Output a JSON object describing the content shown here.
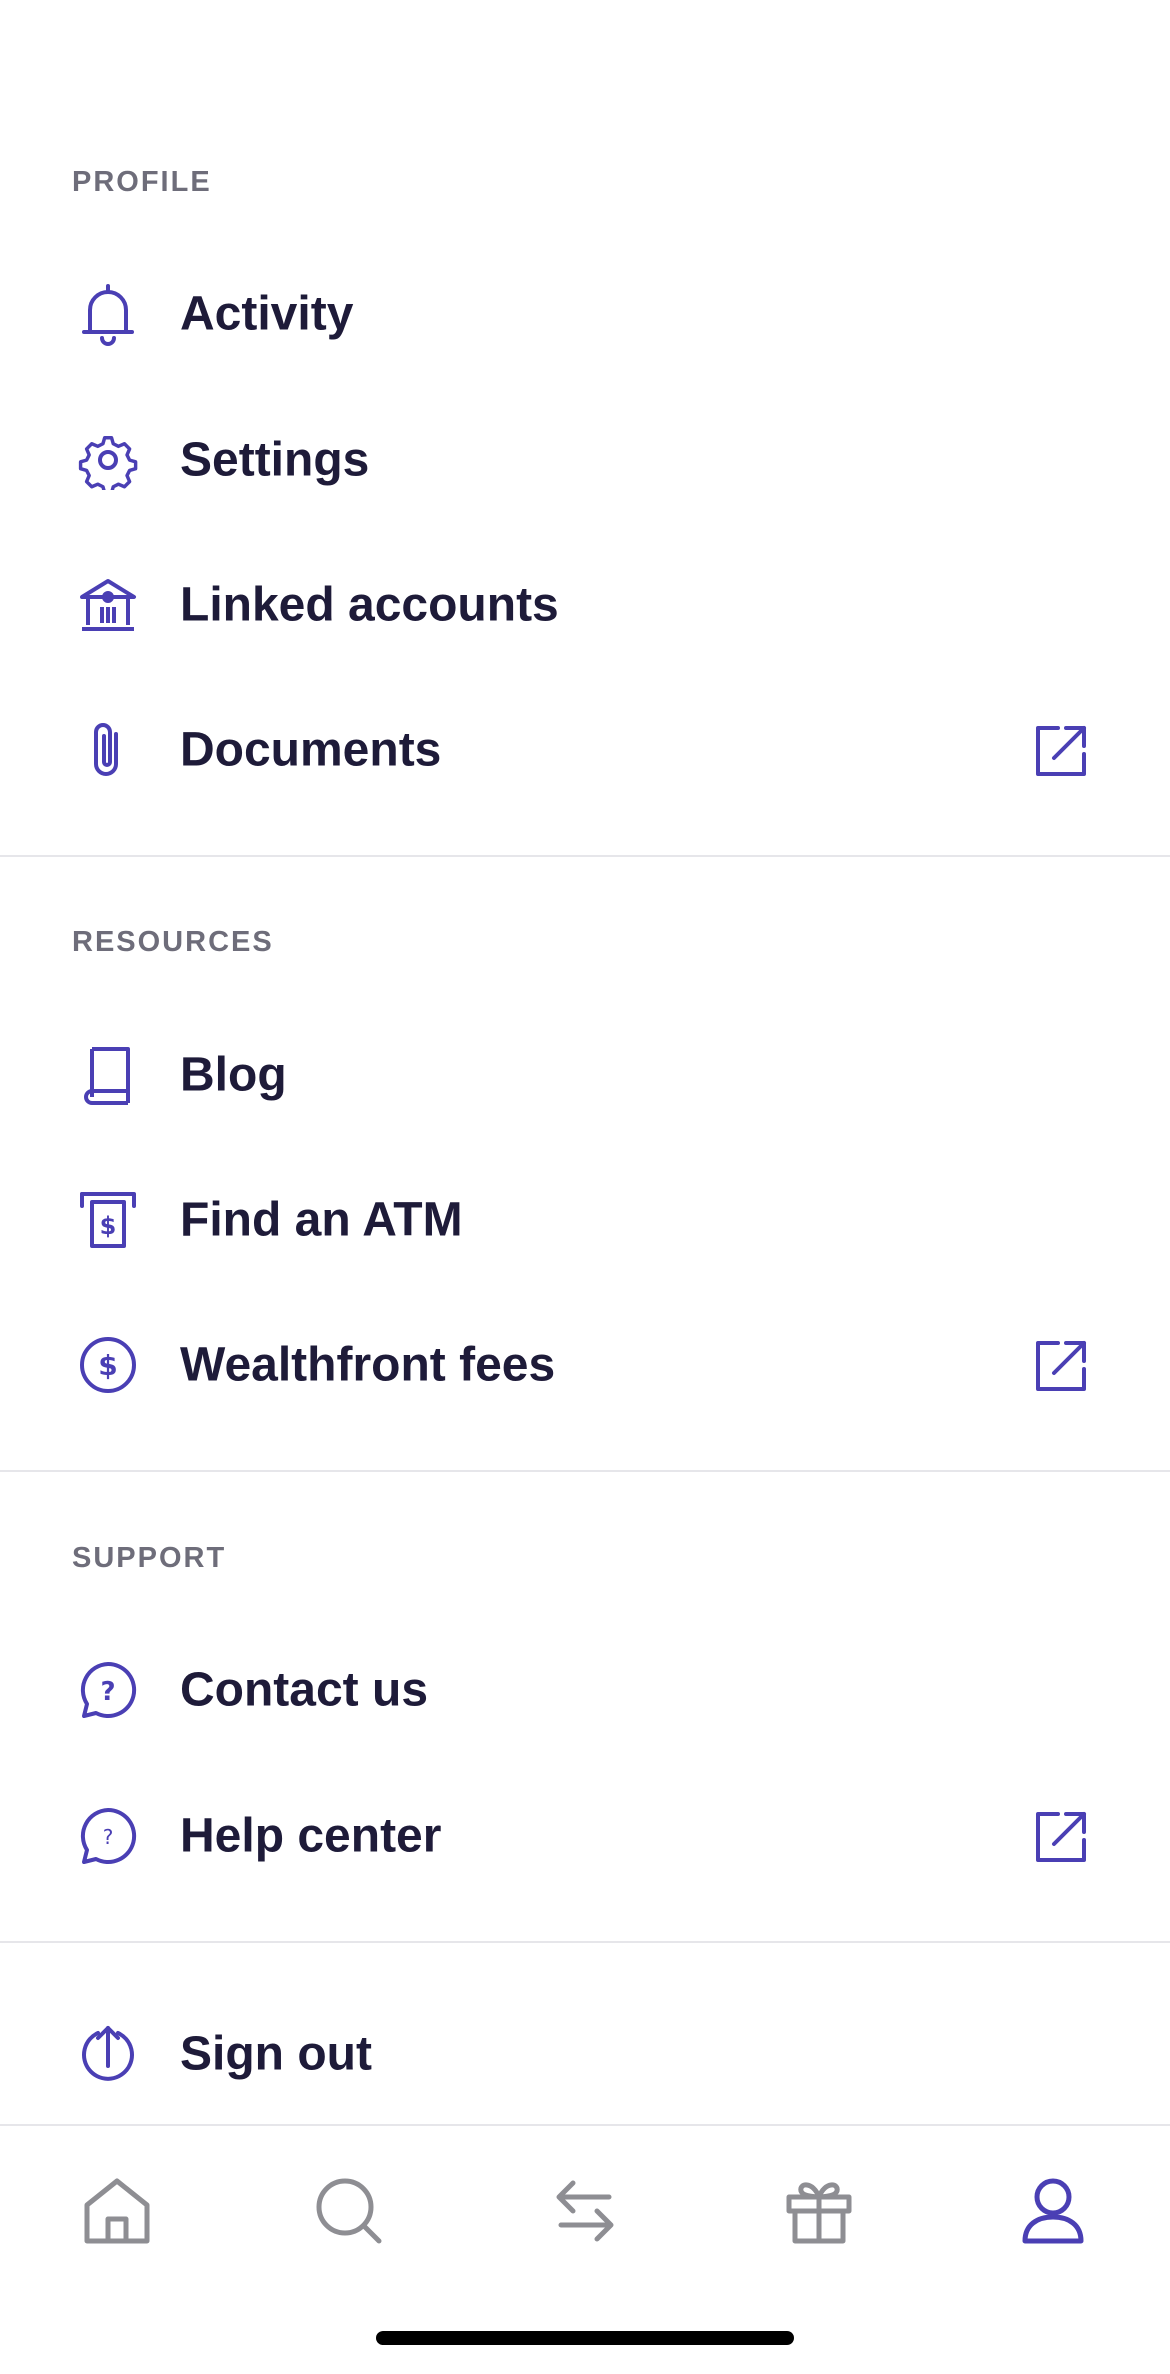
{
  "colors": {
    "accent": "#4a3fb4",
    "text": "#1e1b39",
    "section_title": "#6e6d7a",
    "tab_inactive": "#8e8e93",
    "divider": "#e6e6ea"
  },
  "profile": {
    "title": "PROFILE",
    "items": [
      {
        "label": "Activity",
        "icon": "bell-icon"
      },
      {
        "label": "Settings",
        "icon": "gear-icon"
      },
      {
        "label": "Linked accounts",
        "icon": "bank-icon"
      },
      {
        "label": "Documents",
        "icon": "paperclip-icon",
        "external": true
      }
    ]
  },
  "resources": {
    "title": "RESOURCES",
    "items": [
      {
        "label": "Blog",
        "icon": "book-icon"
      },
      {
        "label": "Find an ATM",
        "icon": "atm-icon"
      },
      {
        "label": "Wealthfront fees",
        "icon": "dollar-circle-icon",
        "external": true
      }
    ]
  },
  "support": {
    "title": "SUPPORT",
    "items": [
      {
        "label": "Contact us",
        "icon": "question-chat-icon"
      },
      {
        "label": "Help center",
        "icon": "question-chat-icon",
        "external": true
      }
    ]
  },
  "sign_out": {
    "label": "Sign out",
    "icon": "sign-out-icon"
  },
  "tabbar": {
    "tabs": [
      {
        "icon": "home-icon",
        "active": false
      },
      {
        "icon": "search-icon",
        "active": false
      },
      {
        "icon": "transfer-icon",
        "active": false
      },
      {
        "icon": "gift-icon",
        "active": false
      },
      {
        "icon": "profile-icon",
        "active": true
      }
    ]
  }
}
